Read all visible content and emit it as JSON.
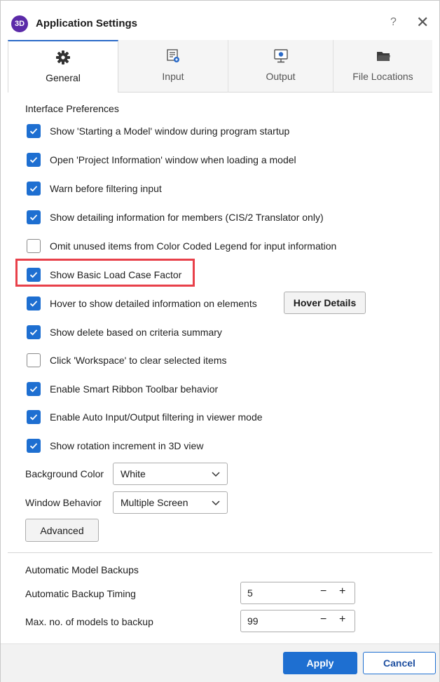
{
  "window": {
    "app_icon_text": "3D",
    "title": "Application Settings",
    "help_glyph": "?",
    "close_glyph": "✕"
  },
  "tabs": [
    {
      "label": "General",
      "icon": "gear-icon",
      "active": true
    },
    {
      "label": "Input",
      "icon": "input-form-icon",
      "active": false
    },
    {
      "label": "Output",
      "icon": "monitor-icon",
      "active": false
    },
    {
      "label": "File Locations",
      "icon": "folder-icon",
      "active": false
    }
  ],
  "interface_preferences": {
    "title": "Interface Preferences",
    "options": [
      {
        "label": "Show 'Starting a Model' window during program startup",
        "checked": true
      },
      {
        "label": "Open 'Project Information' window when loading a model",
        "checked": true
      },
      {
        "label": "Warn before filtering input",
        "checked": true
      },
      {
        "label": "Show detailing information for members (CIS/2 Translator only)",
        "checked": true
      },
      {
        "label": "Omit unused items from Color Coded Legend for input information",
        "checked": false
      },
      {
        "label": "Show Basic Load Case Factor",
        "checked": true
      },
      {
        "label": "Hover to show detailed information on elements",
        "checked": true
      },
      {
        "label": "Show delete based on criteria summary",
        "checked": true
      },
      {
        "label": "Click 'Workspace' to clear selected items",
        "checked": false
      },
      {
        "label": "Enable Smart Ribbon Toolbar behavior",
        "checked": true
      },
      {
        "label": "Enable Auto Input/Output filtering in viewer mode",
        "checked": true
      },
      {
        "label": "Show rotation increment in 3D view",
        "checked": true
      }
    ],
    "hover_details_button": "Hover Details",
    "background_color": {
      "label": "Background Color",
      "value": "White"
    },
    "window_behavior": {
      "label": "Window Behavior",
      "value": "Multiple Screen"
    },
    "advanced_button": "Advanced"
  },
  "backups": {
    "title": "Automatic Model Backups",
    "timing": {
      "label": "Automatic Backup Timing",
      "value": "5"
    },
    "max_models": {
      "label": "Max. no. of models to backup",
      "value": "99"
    },
    "minus_glyph": "−",
    "plus_glyph": "+"
  },
  "footer": {
    "apply": "Apply",
    "cancel": "Cancel"
  },
  "colors": {
    "accent": "#1e6fd1",
    "highlight": "#e8404a",
    "app_icon": "#5b2aa8"
  }
}
